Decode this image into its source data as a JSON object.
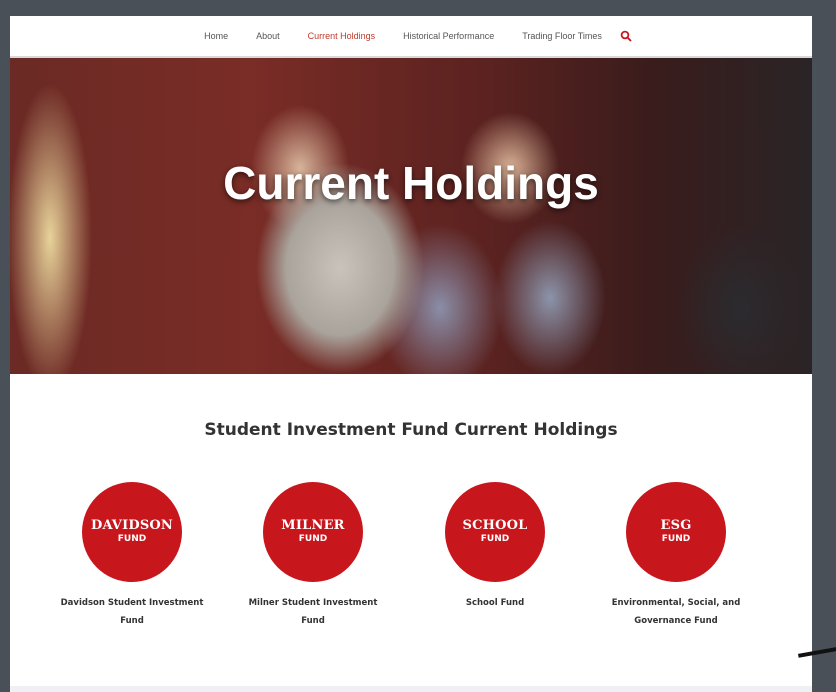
{
  "nav": {
    "items": [
      "Home",
      "About",
      "Current Holdings",
      "Historical Performance",
      "Trading Floor Times"
    ],
    "active_index": 2
  },
  "hero": {
    "title": "Current Holdings"
  },
  "section": {
    "title": "Student Investment Fund Current Holdings"
  },
  "funds": [
    {
      "name": "DAVIDSON",
      "sub": "FUND",
      "caption_line1": "Davidson Student Investment",
      "caption_line2": "Fund"
    },
    {
      "name": "MILNER",
      "sub": "FUND",
      "caption_line1": "Milner Student Investment",
      "caption_line2": "Fund"
    },
    {
      "name": "SCHOOL",
      "sub": "FUND",
      "caption_line1": "School Fund",
      "caption_line2": ""
    },
    {
      "name": "ESG",
      "sub": "FUND",
      "caption_line1": "Environmental, Social, and",
      "caption_line2": "Governance Fund"
    }
  ],
  "colors": {
    "accent": "#c8161d",
    "nav_active": "#c0392b"
  },
  "icons": {
    "search": "search-icon"
  }
}
